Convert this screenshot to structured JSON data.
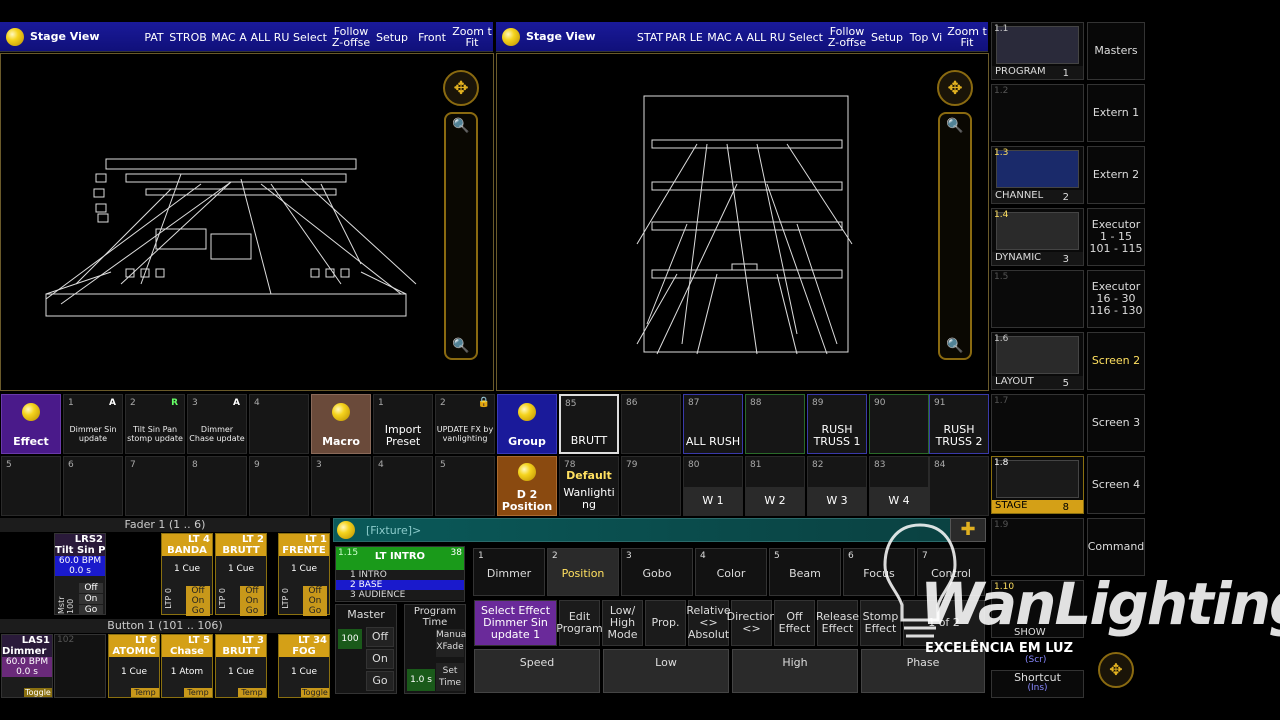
{
  "stage_views": [
    {
      "title": "Stage View",
      "buttons": [
        "PAT",
        "STROB",
        "MAC A",
        "ALL RU",
        "Select",
        "Follow Z-offse",
        "Setup",
        "Front",
        "Zoom t Fit"
      ]
    },
    {
      "title": "Stage View",
      "buttons": [
        "STAT",
        "PAR LE",
        "MAC A",
        "ALL RU",
        "Select",
        "Follow Z-offse",
        "Setup",
        "Top Vi",
        "Zoom t Fit"
      ]
    }
  ],
  "effect_pool": {
    "label": "Effect",
    "items": [
      {
        "n": "1",
        "flag": "A",
        "flag_color": "#ff4040",
        "label": "Dimmer Sin update"
      },
      {
        "n": "2",
        "flag": "R",
        "flag_color": "#40ff40",
        "label": "Tilt Sin Pan stomp update"
      },
      {
        "n": "3",
        "flag": "A",
        "flag_color": "#ff4040",
        "label": "Dimmer Chase update"
      },
      {
        "n": "4",
        "label": ""
      }
    ],
    "row2": [
      "5",
      "6",
      "7",
      "8",
      "9"
    ]
  },
  "macro_pool": {
    "label": "Macro",
    "items": [
      {
        "n": "1",
        "label": "Import Preset"
      },
      {
        "n": "2",
        "label": "UPDATE FX by vanlighting"
      }
    ],
    "row2": [
      "3",
      "4",
      "5"
    ]
  },
  "group_pool": {
    "label": "Group",
    "items": [
      {
        "n": "85",
        "label": "BRUTT"
      },
      {
        "n": "86",
        "label": ""
      },
      {
        "n": "87",
        "label": "ALL RUSH"
      },
      {
        "n": "88",
        "label": ""
      },
      {
        "n": "89",
        "label": "RUSH TRUSS 1"
      },
      {
        "n": "90",
        "label": ""
      },
      {
        "n": "91",
        "label": "RUSH TRUSS 2"
      }
    ]
  },
  "position_pool": {
    "label": "D 2 Position",
    "items": [
      {
        "n": "78",
        "label": "Default",
        "sub": "Wanlighting"
      },
      {
        "n": "79",
        "label": ""
      },
      {
        "n": "80",
        "label": "W 1"
      },
      {
        "n": "81",
        "label": "W 2"
      },
      {
        "n": "82",
        "label": "W 3"
      },
      {
        "n": "83",
        "label": "W 4"
      },
      {
        "n": "84",
        "label": ""
      }
    ]
  },
  "fader_header": "Fader  1 (1 .. 6)",
  "button_header": "Button  1 (101 .. 106)",
  "faders": [
    {
      "n": "2",
      "name": "LRS2",
      "sub": "Tilt Sin P",
      "bpm": "60.0 BPM",
      "time": "0.0 s",
      "mstr": "Mstr 100",
      "states": [
        "Off",
        "On",
        "Go"
      ]
    },
    {
      "n": "4",
      "name": "LT 4",
      "sub": "BANDA",
      "cue": "1 Cue",
      "ltp": "LTP 0",
      "states": [
        "Off",
        "On",
        "Go"
      ]
    },
    {
      "n": "5",
      "name": "LT 2",
      "sub": "BRUTT",
      "cue": "1 Cue",
      "ltp": "LTP 0",
      "states": [
        "Off",
        "On",
        "Go"
      ]
    },
    {
      "n": "6",
      "name": "LT 1",
      "sub": "FRENTE",
      "cue": "1 Cue",
      "ltp": "LTP 0",
      "states": [
        "Off",
        "On",
        "Go"
      ]
    }
  ],
  "buttons": [
    {
      "n": "101",
      "name": "LAS1",
      "sub": "Dimmer",
      "bpm": "60.0 BPM",
      "time": "0.0 s",
      "foot": "Toggle"
    },
    {
      "n": "102",
      "name": "",
      "sub": ""
    },
    {
      "n": "103",
      "name": "LT 6",
      "sub": "ATOMIC",
      "cue": "1 Cue",
      "foot": "Temp"
    },
    {
      "n": "104",
      "name": "LT 5",
      "sub": "Chase",
      "cue": "1 Atom",
      "foot": "Temp"
    },
    {
      "n": "105",
      "name": "LT 3",
      "sub": "BRUTT",
      "cue": "1 Cue",
      "foot": "Temp"
    },
    {
      "n": "106",
      "name": "LT 34",
      "sub": "FOG",
      "cue": "1 Cue",
      "foot": "Toggle"
    }
  ],
  "fixture_bar": {
    "label": "[Fixture]>"
  },
  "sequence": {
    "n": "1.15",
    "title": "LT INTRO",
    "num": "38",
    "cues": [
      "1 INTRO",
      "2 BASE",
      "3 AUDIENCE"
    ]
  },
  "master": {
    "label": "Master",
    "value": "100",
    "states": [
      "Off",
      "On",
      "Go"
    ]
  },
  "program_time": {
    "label": "Program Time",
    "value": "1.0 s",
    "manual": "Manua XFade",
    "set": "Set Time"
  },
  "features": [
    {
      "n": "1",
      "label": "Dimmer"
    },
    {
      "n": "2",
      "label": "Position"
    },
    {
      "n": "3",
      "label": "Gobo"
    },
    {
      "n": "4",
      "label": "Color"
    },
    {
      "n": "5",
      "label": "Beam"
    },
    {
      "n": "6",
      "label": "Focus"
    },
    {
      "n": "7",
      "label": "Control"
    }
  ],
  "effect_buttons": [
    {
      "label": "Select Effect Dimmer Sin update 1"
    },
    {
      "label": "Edit Program"
    },
    {
      "label": "Low/ High Mode"
    },
    {
      "label": "Prop."
    },
    {
      "label": "Relative <> Absolut"
    },
    {
      "label": "Direction <>"
    },
    {
      "label": "Off Effect"
    },
    {
      "label": "Release Effect"
    },
    {
      "label": "Stomp Effect"
    },
    {
      "label": "1 of 2"
    }
  ],
  "encoders": [
    "Speed",
    "Low",
    "High",
    "Phase"
  ],
  "views": [
    {
      "n": "1.1",
      "label": "PROGRAM",
      "count": "1"
    },
    {
      "n": "1.2",
      "label": "",
      "count": ""
    },
    {
      "n": "1.3",
      "label": "CHANNEL",
      "count": "2"
    },
    {
      "n": "1.4",
      "label": "DYNAMIC",
      "count": "3"
    },
    {
      "n": "1.5",
      "label": "",
      "count": ""
    },
    {
      "n": "1.6",
      "label": "LAYOUT",
      "count": "5"
    },
    {
      "n": "1.7",
      "label": "",
      "count": ""
    },
    {
      "n": "1.8",
      "label": "STAGE",
      "count": "8"
    },
    {
      "n": "1.9",
      "label": "",
      "count": ""
    },
    {
      "n": "1.10",
      "label": "SHOW",
      "count": ""
    }
  ],
  "right_buttons": [
    "Masters",
    "Extern 1",
    "Extern 2",
    "Executor 1 - 15 101 - 115",
    "Executor 16 - 30 116 - 130",
    "Screen 2",
    "Screen 3",
    "Screen 4",
    "Command"
  ],
  "shortcut": {
    "label": "Shortcut",
    "sub": "(Ins)"
  },
  "scr_label": "(Scr)",
  "watermark": {
    "brand": "WanLighting",
    "tagline": "EXCELÊNCIA EM LUZ"
  },
  "colors": {
    "accent": "#d4a017",
    "effect": "#4a1a8a",
    "macro": "#6a4a3a",
    "group": "#1a1a9a",
    "selected": "#d4a017"
  }
}
